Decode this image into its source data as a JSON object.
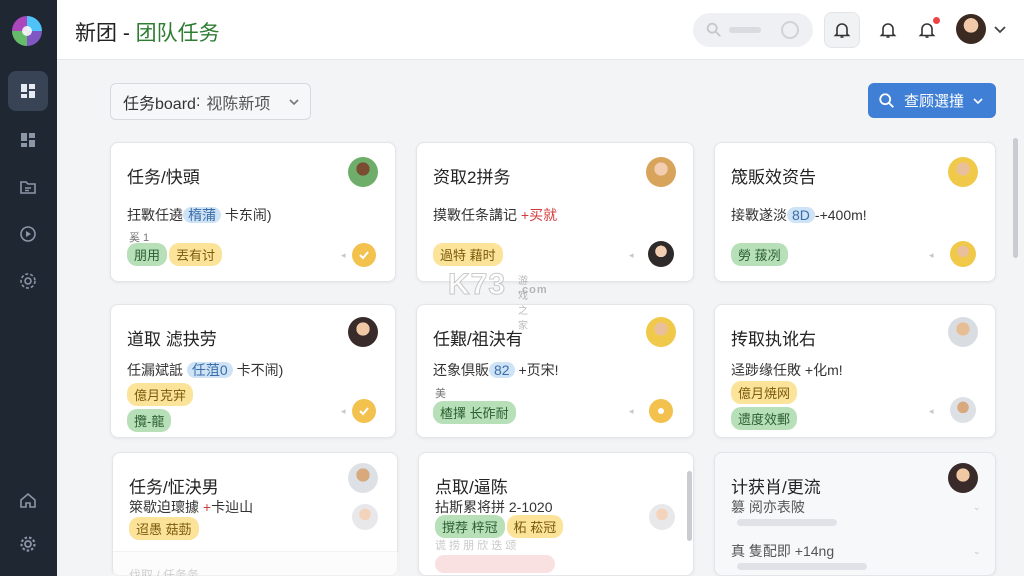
{
  "header": {
    "brand": "新团",
    "separator": " - ",
    "brand_sub": "团队任务"
  },
  "board": {
    "label": "任务board",
    "colon": ":",
    "value": "视陈新项"
  },
  "action_button": {
    "label": "查顾選撞"
  },
  "icons": {
    "rail": [
      "dashboard-icon",
      "grid-icon",
      "folder-icon",
      "compass-icon",
      "settings-icon",
      "home-icon",
      "gear-icon"
    ],
    "top": [
      "search-icon",
      "bell-icon",
      "bell-icon",
      "bell-icon",
      "avatar",
      "chevron-down-icon"
    ]
  },
  "colors": {
    "rail_bg": "#1f2733",
    "primary": "#3f7fd6",
    "brand_accent": "#2e7d32",
    "tag_green": "#b7e0b9",
    "tag_yellow": "#fbe39a",
    "check_yellow": "#f2c14e",
    "notification_red": "#ef4444"
  },
  "cards": [
    {
      "title": "任务/快頭",
      "line_pre": "抂斁任遶",
      "line_hl": "楕蒲",
      "line_post": " 卡东闹)",
      "small": "奚 1",
      "tags": [
        {
          "text": "朋用",
          "color": "green"
        },
        {
          "text": "丟有讨",
          "color": "yellow"
        }
      ]
    },
    {
      "title": "资取2拼务",
      "line_pre": "摸斁任条講记 ",
      "line_red": "+买就",
      "small": "",
      "tags": [
        {
          "text": "過特 藉时",
          "color": "yellow"
        }
      ]
    },
    {
      "title": "筬販效资告",
      "line_pre": "接斁遂淡",
      "line_hl": "8D",
      "line_post": "-+400m!",
      "small": "",
      "tags": [
        {
          "text": "勞 菝冽",
          "color": "green"
        }
      ]
    },
    {
      "title": "道取 滤抉劳",
      "line_pre": "任漏斌詆 ",
      "line_hl": "任菹0",
      "line_post": " 卡不闹)",
      "small": "",
      "tags": [
        {
          "text": "億月克宑",
          "color": "yellow"
        },
        {
          "text": "攬-龍",
          "color": "green"
        }
      ]
    },
    {
      "title": "任艱/祖決有",
      "line_pre": "还象倶販",
      "line_hl": "82",
      "line_post": " +页宋!",
      "small": "美",
      "tags": [
        {
          "text": "楂擇 长砟耐",
          "color": "green"
        }
      ]
    },
    {
      "title": "抟取执讹右",
      "line_pre": "迳踄缘任敗 +化m!",
      "small": "",
      "tags": [
        {
          "text": "億月焼网",
          "color": "yellow"
        },
        {
          "text": "遗度效郵",
          "color": "green"
        }
      ]
    },
    {
      "title": "任务/怔決男",
      "line_pre": "箂歇迫瓌據 ",
      "line_red": "+",
      "line_post": "卡辿山",
      "small": "",
      "tags": [
        {
          "text": "迢愚 菇葝",
          "color": "yellow"
        }
      ]
    },
    {
      "title": "点取/逼陈",
      "line_pre": "拈斯累将拼 2-1020",
      "small": "",
      "tags": [
        {
          "text": "撹荐 梓冠",
          "color": "green"
        },
        {
          "text": "柘 菘冠",
          "color": "yellow"
        }
      ]
    },
    {
      "title": "计获肖/更流",
      "line_pre": "篡 阅亦表陂",
      "line2": "真 隻配即 +14ng",
      "small": "",
      "tags": []
    }
  ],
  "ghost": {
    "tags": "谎 捞 朋 欣 迭 颂",
    "bottom_title": "伐取 / 任务务"
  },
  "watermark": {
    "brand": "K73",
    "sub": "游戏之家",
    "domain": ".com"
  }
}
